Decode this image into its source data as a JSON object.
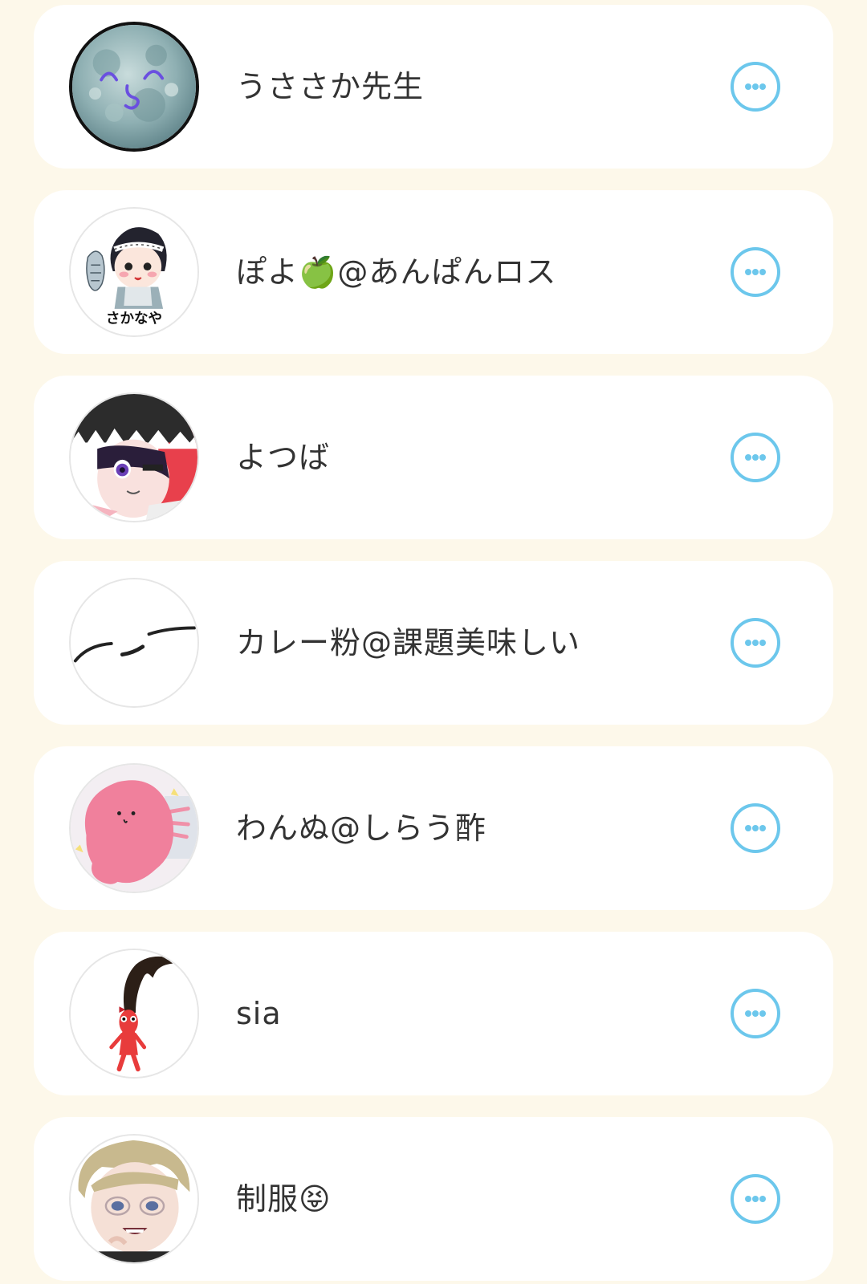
{
  "users": [
    {
      "name": "うささか先生",
      "avatar_icon": "full-moon-face-avatar-icon",
      "more_icon": "more-options-icon"
    },
    {
      "name": "ぽよ🍏@あんぱんロス",
      "avatar_icon": "fishmonger-chibi-avatar-icon",
      "avatar_caption": "さかなや",
      "more_icon": "more-options-icon"
    },
    {
      "name": "よつば",
      "avatar_icon": "shark-hood-boy-avatar-icon",
      "more_icon": "more-options-icon"
    },
    {
      "name": "カレー粉@課題美味しい",
      "avatar_icon": "sleepy-eyes-sketch-avatar-icon",
      "more_icon": "more-options-icon"
    },
    {
      "name": "わんぬ@しらう酢",
      "avatar_icon": "pink-blob-avatar-icon",
      "more_icon": "more-options-icon"
    },
    {
      "name": "sia",
      "avatar_icon": "red-pikmin-avatar-icon",
      "more_icon": "more-options-icon"
    },
    {
      "name": "制服😝",
      "avatar_icon": "blond-glasses-boy-avatar-icon",
      "more_icon": "more-options-icon"
    }
  ],
  "colors": {
    "background": "#fdf8ea",
    "card": "#ffffff",
    "accent": "#6cc7ec",
    "text": "#333333"
  }
}
